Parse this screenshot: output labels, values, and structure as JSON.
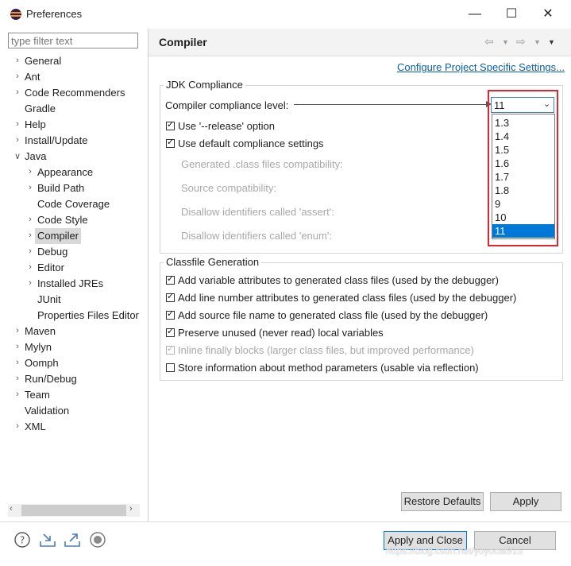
{
  "window": {
    "title": "Preferences",
    "controls": [
      "minimize",
      "maximize",
      "close"
    ]
  },
  "sidebar": {
    "filter_placeholder": "type filter text",
    "items": [
      {
        "label": "General"
      },
      {
        "label": "Ant"
      },
      {
        "label": "Code Recommenders"
      },
      {
        "label": "Gradle"
      },
      {
        "label": "Help"
      },
      {
        "label": "Install/Update"
      },
      {
        "label": "Java"
      },
      {
        "label": "Appearance"
      },
      {
        "label": "Build Path"
      },
      {
        "label": "Code Coverage"
      },
      {
        "label": "Code Style"
      },
      {
        "label": "Compiler"
      },
      {
        "label": "Debug"
      },
      {
        "label": "Editor"
      },
      {
        "label": "Installed JREs"
      },
      {
        "label": "JUnit"
      },
      {
        "label": "Properties Files Editor"
      },
      {
        "label": "Maven"
      },
      {
        "label": "Mylyn"
      },
      {
        "label": "Oomph"
      },
      {
        "label": "Run/Debug"
      },
      {
        "label": "Team"
      },
      {
        "label": "Validation"
      },
      {
        "label": "XML"
      }
    ],
    "selected": "Compiler"
  },
  "main": {
    "title": "Compiler",
    "config_link": "Configure Project Specific Settings...",
    "jdk_group": {
      "label": "JDK Compliance",
      "level_label": "Compiler compliance level:",
      "level_value": "11",
      "release_option": {
        "label": "Use '--release' option",
        "checked": true
      },
      "default_settings": {
        "label": "Use default compliance settings",
        "checked": true
      },
      "disabled_rows": [
        "Generated .class files compatibility:",
        "Source compatibility:",
        "Disallow identifiers called 'assert':",
        "Disallow identifiers called 'enum':"
      ]
    },
    "dropdown_options": [
      "1.3",
      "1.4",
      "1.5",
      "1.6",
      "1.7",
      "1.8",
      "9",
      "10",
      "11"
    ],
    "dropdown_selected": "11",
    "classfile_group": {
      "label": "Classfile Generation",
      "options": [
        {
          "label": "Add variable attributes to generated class files (used by the debugger)",
          "checked": true,
          "enabled": true
        },
        {
          "label": "Add line number attributes to generated class files (used by the debugger)",
          "checked": true,
          "enabled": true
        },
        {
          "label": "Add source file name to generated class file (used by the debugger)",
          "checked": true,
          "enabled": true
        },
        {
          "label": "Preserve unused (never read) local variables",
          "checked": true,
          "enabled": true
        },
        {
          "label": "Inline finally blocks (larger class files, but improved performance)",
          "checked": true,
          "enabled": false
        },
        {
          "label": "Store information about method parameters (usable via reflection)",
          "checked": false,
          "enabled": true
        }
      ]
    },
    "restore_defaults": "Restore Defaults",
    "apply": "Apply"
  },
  "footer": {
    "apply_close": "Apply and Close",
    "cancel": "Cancel",
    "icons": [
      "help-icon",
      "import-icon",
      "export-icon",
      "record-icon"
    ],
    "watermark": "https://blog.csdn.net/yoyocat915"
  },
  "colors": {
    "selection": "#0078d7",
    "highlight_box": "#e0262f",
    "link": "#0b5ea8"
  }
}
